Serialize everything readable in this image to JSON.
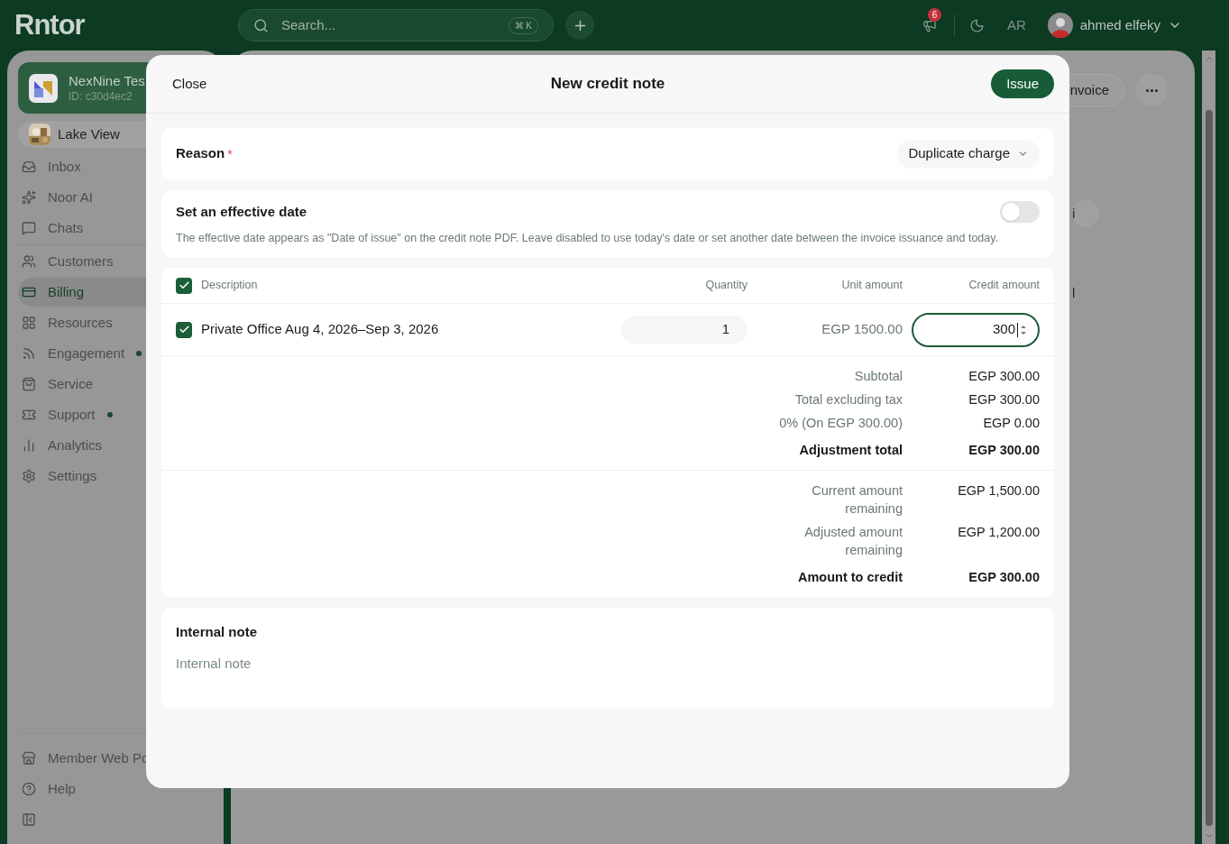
{
  "app": {
    "logo": "Rntor",
    "search": {
      "placeholder": "Search...",
      "shortcut": "⌘ K"
    },
    "notifications": {
      "count": "6"
    },
    "language": "AR",
    "user": {
      "name": "ahmed elfeky"
    }
  },
  "sidebar": {
    "workspace": {
      "name": "NexNine Tes",
      "id": "ID: c30d4ec2"
    },
    "location": "Lake View",
    "items": [
      {
        "label": "Inbox",
        "selected": false,
        "dot": false
      },
      {
        "label": "Noor AI",
        "selected": false,
        "dot": false
      },
      {
        "label": "Chats",
        "selected": false,
        "dot": false
      },
      {
        "label": "Customers",
        "selected": false,
        "dot": false
      },
      {
        "label": "Billing",
        "selected": true,
        "dot": false
      },
      {
        "label": "Resources",
        "selected": false,
        "dot": false
      },
      {
        "label": "Engagement",
        "selected": false,
        "dot": true
      },
      {
        "label": "Service",
        "selected": false,
        "dot": false
      },
      {
        "label": "Support",
        "selected": false,
        "dot": true
      },
      {
        "label": "Analytics",
        "selected": false,
        "dot": false
      },
      {
        "label": "Settings",
        "selected": false,
        "dot": false
      }
    ],
    "footer": [
      "Member Web Po",
      "Help"
    ]
  },
  "page": {
    "button": "nvoice",
    "fragments": [
      "i",
      "l"
    ]
  },
  "modal": {
    "close": "Close",
    "title": "New credit note",
    "primary": "Issue",
    "reason": {
      "label": "Reason",
      "required_mark": "*",
      "value": "Duplicate charge"
    },
    "effective_date": {
      "title": "Set an effective date",
      "on": false,
      "help": "The effective date appears as \"Date of issue\" on the credit note PDF. Leave disabled to use today's date or set another date between the invoice issuance and today."
    },
    "table": {
      "all_checked": true,
      "columns": [
        "Description",
        "Quantity",
        "Unit amount",
        "Credit amount"
      ],
      "rows": [
        {
          "checked": true,
          "description": "Private Office Aug 4, 2026–Sep 3, 2026",
          "quantity": "1",
          "unit_amount": "EGP 1500.00",
          "credit_amount": "300"
        }
      ]
    },
    "totals": [
      {
        "label": "Subtotal",
        "value": "EGP 300.00",
        "kind": "line"
      },
      {
        "label": "Total excluding tax",
        "value": "EGP 300.00",
        "kind": "line"
      },
      {
        "label": "0% (On EGP 300.00)",
        "value": "EGP 0.00",
        "kind": "line"
      },
      {
        "label": "Adjustment total",
        "value": "EGP 300.00",
        "kind": "total"
      }
    ],
    "summary": [
      {
        "label": "Current amount remaining",
        "value": "EGP 1,500.00",
        "kind": "line"
      },
      {
        "label": "Adjusted amount remaining",
        "value": "EGP 1,200.00",
        "kind": "line"
      },
      {
        "label": "Amount to credit",
        "value": "EGP 300.00",
        "kind": "total"
      }
    ],
    "internal_note": {
      "title": "Internal note",
      "placeholder": "Internal note"
    }
  }
}
